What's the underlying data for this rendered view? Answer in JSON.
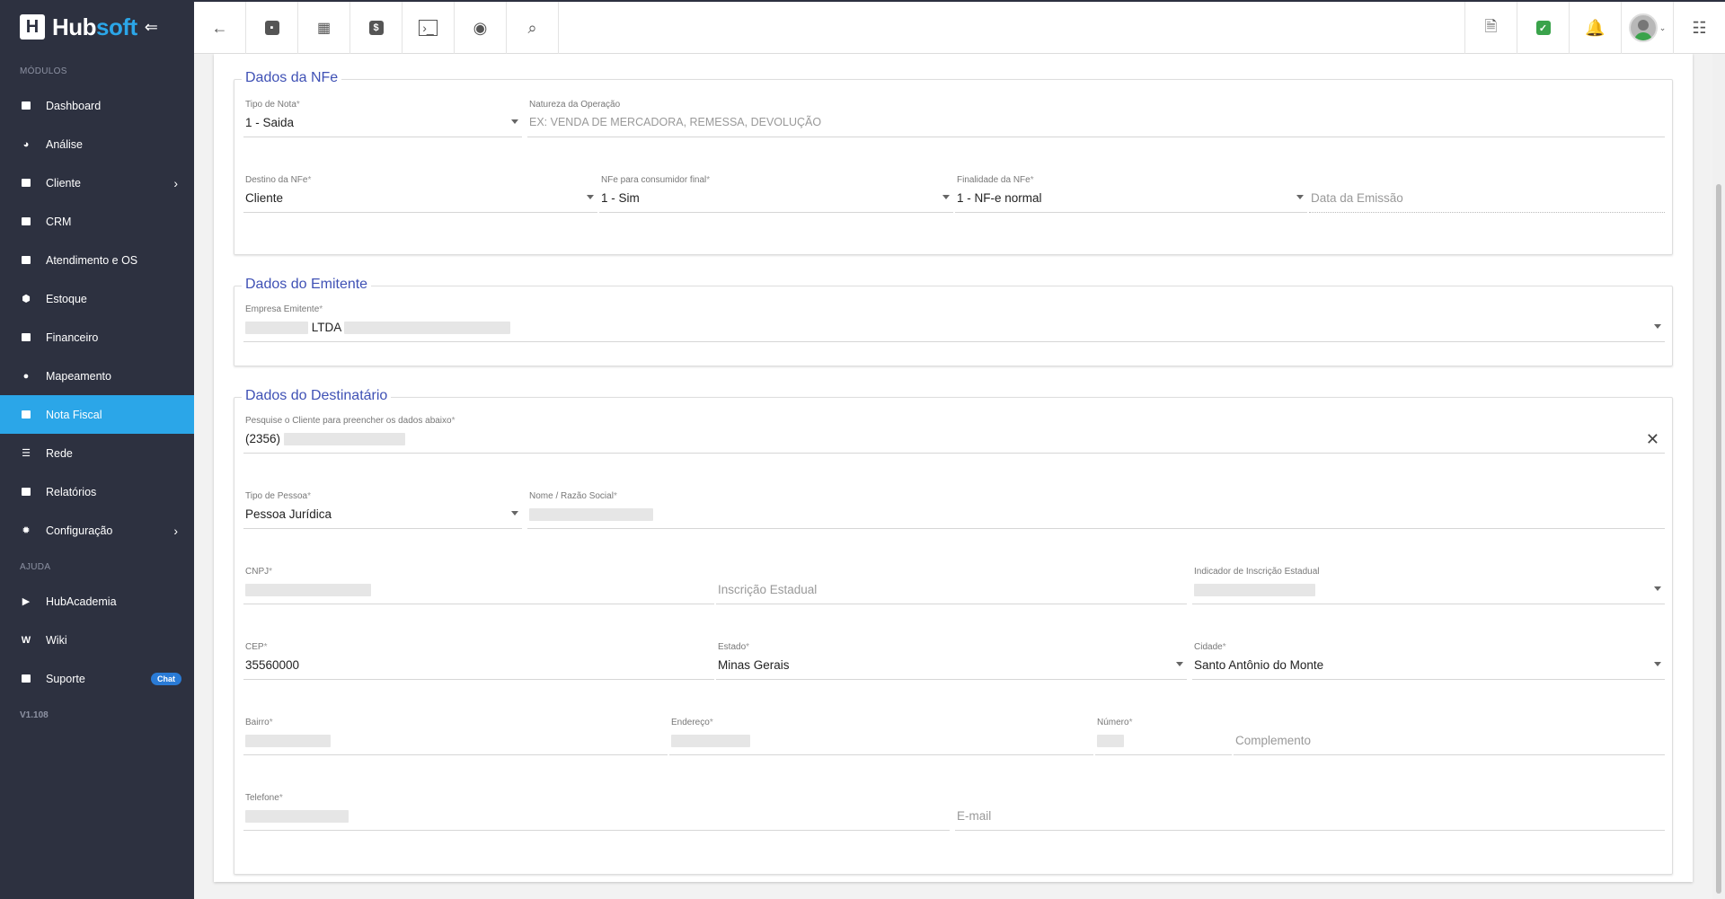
{
  "sidebar": {
    "logo": {
      "hub": "Hub",
      "soft": "soft"
    },
    "section_modulos": "MÓDULOS",
    "items": [
      {
        "label": "Dashboard"
      },
      {
        "label": "Análise"
      },
      {
        "label": "Cliente"
      },
      {
        "label": "CRM"
      },
      {
        "label": "Atendimento e OS"
      },
      {
        "label": "Estoque"
      },
      {
        "label": "Financeiro"
      },
      {
        "label": "Mapeamento"
      },
      {
        "label": "Nota Fiscal"
      },
      {
        "label": "Rede"
      },
      {
        "label": "Relatórios"
      },
      {
        "label": "Configuração"
      }
    ],
    "section_ajuda": "AJUDA",
    "help_items": [
      {
        "label": "HubAcademia"
      },
      {
        "label": "Wiki"
      },
      {
        "label": "Suporte",
        "badge": "Chat"
      }
    ],
    "version": "V1.108"
  },
  "colors": {
    "sidebar_bg": "#2d3140",
    "accent": "#2ba6e8",
    "legend": "#3f51b5",
    "badge": "#2a7bd6",
    "success": "#3aa34b",
    "alert": "#e53935"
  },
  "nfe": {
    "legend": "Dados da NFe",
    "tipo_nota": {
      "label": "Tipo de Nota",
      "value": "1 - Saida"
    },
    "natureza": {
      "label": "Natureza da Operação",
      "placeholder": "EX: VENDA DE MERCADORA, REMESSA, DEVOLUÇÃO"
    },
    "destino": {
      "label": "Destino da NFe",
      "value": "Cliente"
    },
    "consumidor": {
      "label": "NFe para consumidor final",
      "value": "1 - Sim"
    },
    "finalidade": {
      "label": "Finalidade da NFe",
      "value": "1 - NF-e normal"
    },
    "data_emissao": {
      "placeholder": "Data da Emissão"
    }
  },
  "emitente": {
    "legend": "Dados do Emitente",
    "empresa": {
      "label": "Empresa Emitente",
      "value": "LTDA"
    }
  },
  "destinatario": {
    "legend": "Dados do Destinatário",
    "pesquisa": {
      "label": "Pesquise o Cliente para preencher os dados abaixo",
      "value": "(2356)"
    },
    "tipo_pessoa": {
      "label": "Tipo de Pessoa",
      "value": "Pessoa Jurídica"
    },
    "nome": {
      "label": "Nome / Razão Social"
    },
    "cnpj": {
      "label": "CNPJ"
    },
    "inscricao": {
      "placeholder": "Inscrição Estadual"
    },
    "indicador": {
      "label": "Indicador de Inscrição Estadual"
    },
    "cep": {
      "label": "CEP",
      "value": "35560000"
    },
    "estado": {
      "label": "Estado",
      "value": "Minas Gerais"
    },
    "cidade": {
      "label": "Cidade",
      "value": "Santo Antônio do Monte"
    },
    "bairro": {
      "label": "Bairro"
    },
    "endereco": {
      "label": "Endereço"
    },
    "numero": {
      "label": "Número"
    },
    "complemento": {
      "placeholder": "Complemento"
    },
    "telefone": {
      "label": "Telefone"
    },
    "email": {
      "placeholder": "E-mail"
    }
  }
}
